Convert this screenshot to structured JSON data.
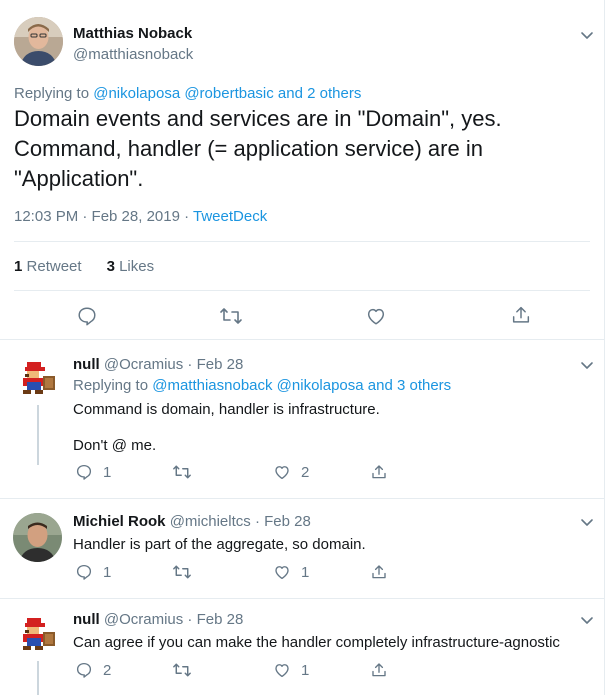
{
  "main_tweet": {
    "author_name": "Matthias Noback",
    "author_handle": "@matthiasnoback",
    "replying_prefix": "Replying to",
    "replying_to": "@nikolaposa @robertbasic and 2 others",
    "text_line1": "Domain events and services are in \"Domain\", yes.",
    "text_line2": "Command, handler (= application service) are in",
    "text_line3": "\"Application\".",
    "timestamp": "12:03 PM · Feb 28, 2019 · ",
    "source": "TweetDeck",
    "retweet_count": "1",
    "retweet_label": "Retweet",
    "like_count": "3",
    "like_label": "Likes"
  },
  "replies": [
    {
      "name": "null",
      "handle": "@Ocramius",
      "date": "· Feb 28",
      "replying_prefix": "Replying to",
      "replying_to": "@matthiasnoback @nikolaposa and 3 others",
      "text_line1": "Command is domain, handler is infrastructure.",
      "text_line2": "Don't @ me.",
      "reply_count": "1",
      "retweet_count": "",
      "like_count": "2"
    },
    {
      "name": "Michiel Rook",
      "handle": "@michieltcs",
      "date": "· Feb 28",
      "text_line1": "Handler is part of the aggregate, so domain.",
      "reply_count": "1",
      "retweet_count": "",
      "like_count": "1"
    },
    {
      "name": "null",
      "handle": "@Ocramius",
      "date": "· Feb 28",
      "text_line1": "Can agree if you can make the handler completely infrastructure-agnostic",
      "reply_count": "2",
      "retweet_count": "",
      "like_count": "1"
    }
  ],
  "colors": {
    "link": "#1b95e0",
    "muted": "#657786",
    "text": "#14171a",
    "border": "#e6ecf0"
  },
  "icons": [
    "chevron-down-icon",
    "reply-icon",
    "retweet-icon",
    "like-icon",
    "share-icon"
  ]
}
